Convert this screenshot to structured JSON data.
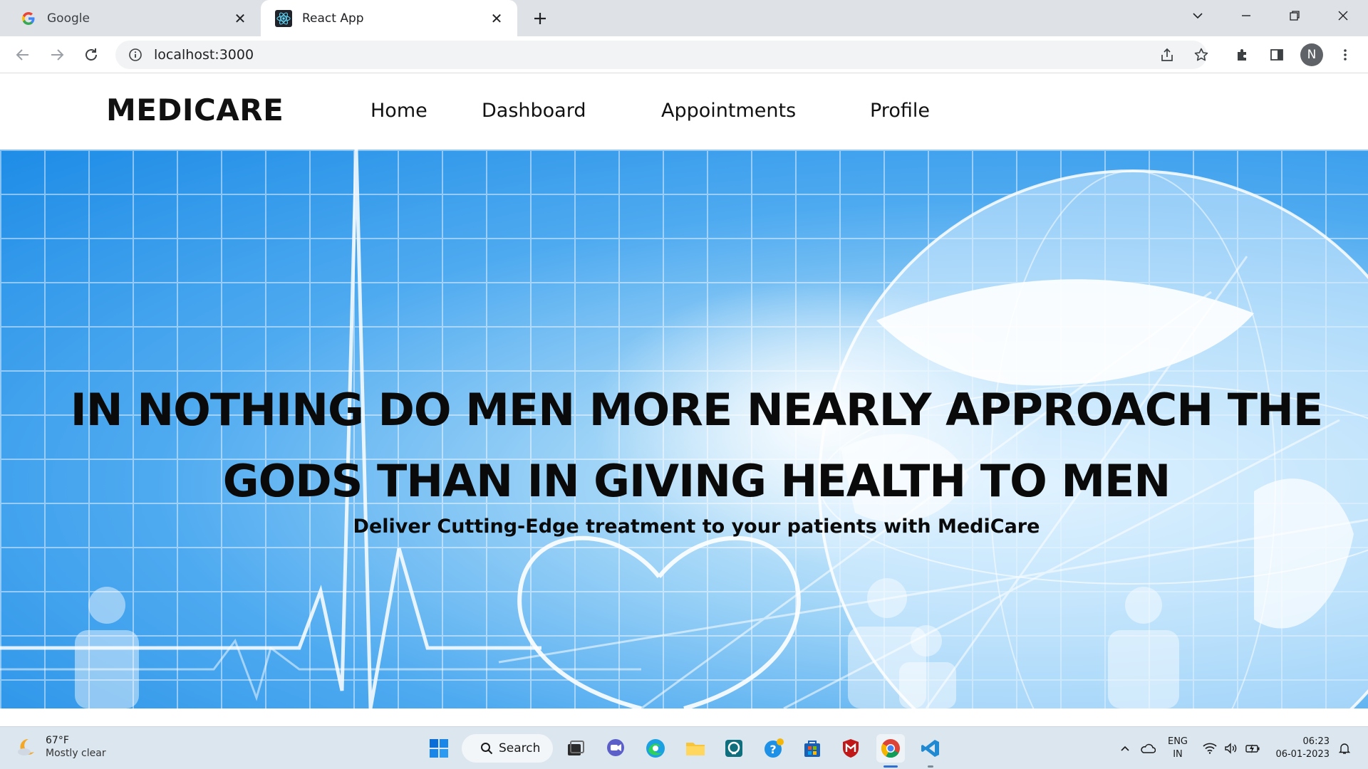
{
  "browser": {
    "tabs": [
      {
        "title": "Google",
        "favicon": "google-g-icon",
        "active": false
      },
      {
        "title": "React App",
        "favicon": "react-logo-icon",
        "active": true
      }
    ],
    "address": "localhost:3000",
    "profile_initial": "N"
  },
  "site": {
    "logo": "MEDICARE",
    "nav": [
      "Home",
      "Dashboard",
      "Appointments",
      "Profile"
    ],
    "hero": {
      "title_line1": "IN NOTHING DO MEN MORE NEARLY APPROACH THE",
      "title_line2": "GODS THAN IN GIVING HEALTH TO MEN",
      "subtitle": "Deliver Cutting-Edge treatment to your patients with MediCare"
    }
  },
  "taskbar": {
    "weather": {
      "temp": "67°F",
      "condition": "Mostly clear"
    },
    "search_label": "Search",
    "lang_line1": "ENG",
    "lang_line2": "IN",
    "time": "06:23",
    "date": "06-01-2023"
  },
  "colors": {
    "hero_blue": "#1e8ce6",
    "taskbar": "#dbe6ef",
    "tabstrip": "#dee1e6"
  }
}
